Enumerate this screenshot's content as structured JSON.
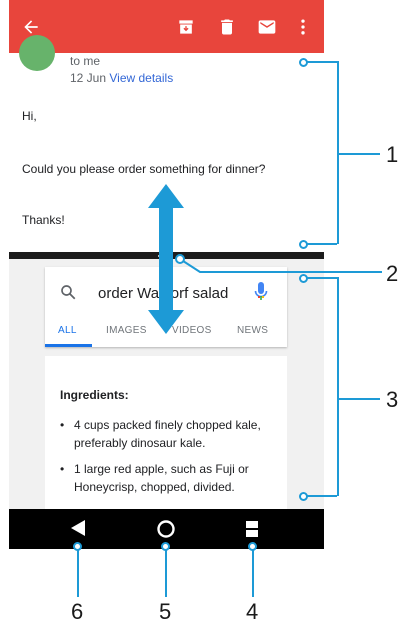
{
  "email": {
    "toolbar": {
      "back_icon": "arrow-back-icon",
      "archive_icon": "archive-icon",
      "delete_icon": "trash-icon",
      "mail_icon": "mail-icon",
      "more_icon": "more-vert-icon",
      "color": "#e8453c"
    },
    "recipient": "to me",
    "date": "12 Jun",
    "view_details": "View details",
    "body": {
      "greeting": "Hi,",
      "message": "Could you please order something for dinner?",
      "signoff": "Thanks!"
    }
  },
  "browser": {
    "query": "order Waldorf salad",
    "tabs": [
      "ALL",
      "IMAGES",
      "VIDEOS",
      "NEWS"
    ],
    "active_tab": "ALL",
    "accent": "#1a73e8",
    "heading": "Ingredients:",
    "items": [
      "4 cups packed finely chopped kale, preferably dinosaur kale.",
      "1 large red apple, such as Fuji or Honeycrisp, chopped, divided."
    ]
  },
  "navigation": {
    "back_icon": "back-triangle-icon",
    "home_icon": "home-circle-icon",
    "recents_icon": "recents-icon"
  },
  "callouts": [
    "1",
    "2",
    "3",
    "4",
    "5",
    "6"
  ],
  "callout_color": "#1d9ad6"
}
